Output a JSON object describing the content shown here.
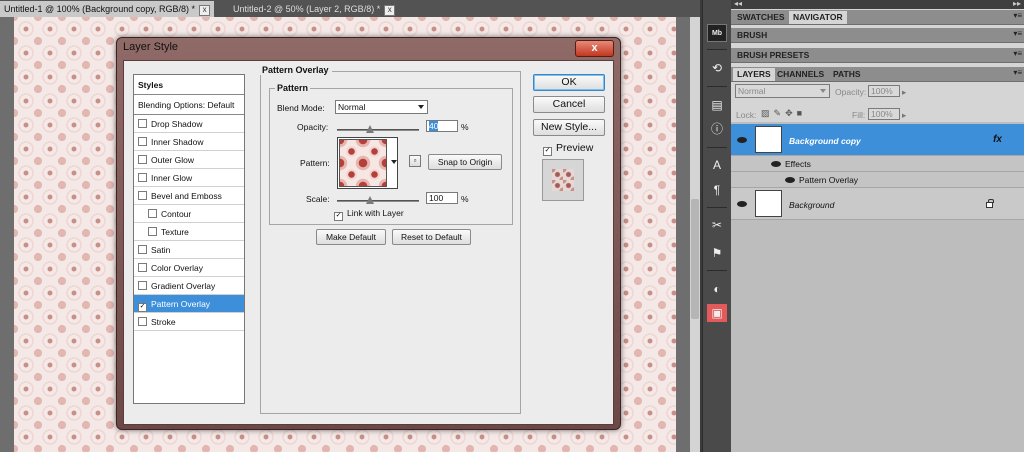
{
  "documents": {
    "tabs": [
      {
        "label": "Untitled-1 @ 100% (Background copy, RGB/8) *",
        "active": true
      },
      {
        "label": "Untitled-2 @ 50% (Layer 2, RGB/8) *",
        "active": false
      }
    ],
    "close_glyph": "x"
  },
  "dialog": {
    "title": "Layer Style",
    "close_glyph": "x",
    "styles_list": {
      "header": "Styles",
      "blending": "Blending Options: Default",
      "items": [
        {
          "label": "Drop Shadow",
          "checked": false,
          "sub": false
        },
        {
          "label": "Inner Shadow",
          "checked": false,
          "sub": false
        },
        {
          "label": "Outer Glow",
          "checked": false,
          "sub": false
        },
        {
          "label": "Inner Glow",
          "checked": false,
          "sub": false
        },
        {
          "label": "Bevel and Emboss",
          "checked": false,
          "sub": false
        },
        {
          "label": "Contour",
          "checked": false,
          "sub": true
        },
        {
          "label": "Texture",
          "checked": false,
          "sub": true
        },
        {
          "label": "Satin",
          "checked": false,
          "sub": false
        },
        {
          "label": "Color Overlay",
          "checked": false,
          "sub": false
        },
        {
          "label": "Gradient Overlay",
          "checked": false,
          "sub": false
        },
        {
          "label": "Pattern Overlay",
          "checked": true,
          "sub": false,
          "selected": true
        },
        {
          "label": "Stroke",
          "checked": false,
          "sub": false
        }
      ]
    },
    "pattern_overlay": {
      "group_title": "Pattern Overlay",
      "pattern_group_title": "Pattern",
      "blend_mode_label": "Blend Mode:",
      "blend_mode_value": "Normal",
      "opacity_label": "Opacity:",
      "opacity_value": "40",
      "opacity_fraction": 0.4,
      "percent": "%",
      "pattern_label": "Pattern:",
      "snap_button": "Snap to Origin",
      "scale_label": "Scale:",
      "scale_value": "100",
      "scale_fraction": 0.4,
      "link_label": "Link with Layer",
      "link_checked": true,
      "make_default": "Make Default",
      "reset_default": "Reset to Default",
      "check_glyph": "✓"
    },
    "buttons": {
      "ok": "OK",
      "cancel": "Cancel",
      "new_style": "New Style...",
      "preview_label": "Preview",
      "preview_checked": true
    }
  },
  "toolbar": {
    "icons": [
      {
        "name": "mini-bridge-icon",
        "glyph": "Mb"
      },
      {
        "name": "history-icon",
        "glyph": "⟲"
      },
      {
        "name": "histogram-icon",
        "glyph": "▤"
      },
      {
        "name": "info-icon",
        "glyph": "ⓘ"
      },
      {
        "name": "character-icon",
        "glyph": "A"
      },
      {
        "name": "paragraph-icon",
        "glyph": "¶"
      },
      {
        "name": "tool-presets-icon",
        "glyph": "✂"
      },
      {
        "name": "clone-source-icon",
        "glyph": "⚑"
      },
      {
        "name": "adjustments-icon",
        "glyph": "◐"
      },
      {
        "name": "masks-icon",
        "glyph": "▣"
      }
    ]
  },
  "panels": {
    "top_strip": {
      "left": "◂◂",
      "right": "▸▸"
    },
    "menu_glyph": "▾≡",
    "group1": {
      "tabs": [
        "SWATCHES",
        "NAVIGATOR"
      ],
      "active": 1
    },
    "group2": {
      "tabs": [
        "BRUSH"
      ],
      "active": 0
    },
    "group3": {
      "tabs": [
        "BRUSH PRESETS"
      ],
      "active": 0
    },
    "group4": {
      "tabs": [
        "LAYERS",
        "CHANNELS",
        "PATHS"
      ],
      "active": 0
    },
    "layers": {
      "blend_mode": "Normal",
      "opacity_label": "Opacity:",
      "opacity_value": "100%",
      "lock_label": "Lock:",
      "fill_label": "Fill:",
      "fill_value": "100%",
      "rows": [
        {
          "name": "Background copy",
          "selected": true,
          "fx": "fx"
        },
        {
          "name": "Background",
          "selected": false
        }
      ],
      "effects_label": "Effects",
      "effect_items": [
        "Pattern Overlay"
      ]
    }
  },
  "colors": {
    "selection_blue": "#3d8fd9",
    "dialog_frame": "#8f6a67",
    "close_red": "#c2371f",
    "canvas_pink": "#f4e9e7"
  }
}
